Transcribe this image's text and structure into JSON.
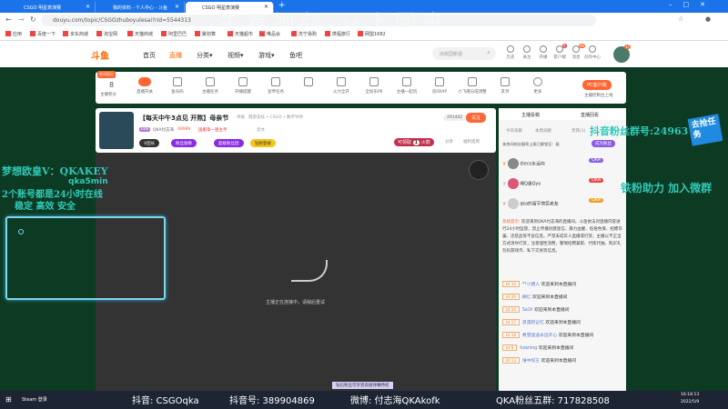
{
  "browser": {
    "tabs": [
      {
        "title": "CSGO 明星表演赛",
        "active": false
      },
      {
        "title": "我的资料 - 个人中心 - 斗鱼",
        "active": false
      },
      {
        "title": "CSGO 明星表演赛",
        "active": true
      }
    ],
    "url": "douyu.com/topic/CSGOzhuboyulesai?rid=5544313",
    "bookmarks": [
      "应用",
      "百度一下",
      "京东商城",
      "淘宝网",
      "天猫商城",
      "阿里巴巴",
      "聚划算",
      "天猫超市",
      "唯品会",
      "苏宁易购",
      "携程旅行",
      "网盟1682"
    ]
  },
  "watermark": "牛看视频 马上回来",
  "header": {
    "logo": "斗鱼",
    "nav": [
      "首页",
      "直播",
      "分类▾",
      "视频▾",
      "游戏▾",
      "鱼吧"
    ],
    "active_nav": "直播",
    "search_placeholder": "出校园新视",
    "icons": [
      "历史",
      "关注",
      "开播",
      "客户端",
      "消息",
      "创作中心"
    ],
    "msg_badge": "99",
    "client_badge": "9",
    "avatar_badge": "17"
  },
  "toolbar": {
    "score_tag": "房间积分",
    "score": "8",
    "score_label": "主播积分",
    "items": [
      "直播开关",
      "鱼乐码",
      "主播任务",
      "开播提醒",
      "宣传任务",
      "火力全开",
      "全民乐PK",
      "主播一起玩",
      "房间VIP",
      "小飞碟分成调整",
      "友邻",
      "更多"
    ],
    "pc_button": "PC客户端",
    "pc_sub": "主播控制台上线"
  },
  "room": {
    "title": "【每天中午3点见 开熬】母亲节",
    "tag": "举报",
    "category": "网游竞技 • CSGO • 数字导师",
    "level": "LV8",
    "anchor": "QKA付志海",
    "hot": "48989",
    "rank": "国服第一狙主手",
    "location": "云文",
    "pills": [
      "V团长",
      "粉丝勋章",
      "超级粉丝团",
      "钻粉登录"
    ],
    "follow_count": "291402",
    "follow": "关注",
    "fire": "可领取",
    "fire_num": "1",
    "fire_suffix": "火箭",
    "share": "分享",
    "report": "福利签到"
  },
  "video": {
    "status": "主播正在连接中，请稍后重试"
  },
  "chat": {
    "tabs": [
      "主播投稿",
      "直播回看"
    ],
    "rank_tabs": [
      "今日贡献",
      "本周贡献",
      "贵宾(1)"
    ],
    "upgrade_text": "本房间粉丝徽章上限已解锁至：级",
    "upgrade_button": "成为粉丝",
    "top": [
      {
        "name": "dieco永远向",
        "badge": "QKA"
      },
      {
        "name": "啊Q是Qyo",
        "badge": "QKA"
      },
      {
        "name": "qka的富平营民老友",
        "badge": "QKA"
      }
    ],
    "system_label": "系统提示:",
    "system": "欢迎来到QKA付志海的直播间。斗鱼依法对直播内容进行24小时监管，禁止传播封建迷信、暴力血腥、低俗色情、招嫖诈骗、违禁品等不良信息。严禁未成年人直播或打赏，主播以不正当方式诱导打赏，注意理性消费，警惕招聘兼职、代练代抽、购买礼包码游戏币、私下交易等信息。",
    "messages": [
      {
        "lv": "LV 10",
        "name": "**小猪人",
        "text": "欢迎来到本直播间"
      },
      {
        "lv": "LV 20",
        "name": "摘忆",
        "text": "欢迎来到本直播间"
      },
      {
        "lv": "LV 24",
        "name": "Sa1li",
        "text": "欢迎来到本直播间"
      },
      {
        "lv": "LV 17",
        "name": "浪漫的记忆",
        "text": "欢迎来到本直播间"
      },
      {
        "lv": "LV 18",
        "name": "希望迪迪永远开心",
        "text": "欢迎来到本直播间"
      },
      {
        "lv": "LV 8",
        "name": "hzaning",
        "text": "欢迎来到本直播间"
      },
      {
        "lv": "LV 13",
        "name": "谁中校王",
        "text": "欢迎来到本直播间"
      }
    ]
  },
  "overlay": {
    "left": [
      "梦想欧皇V：QKAKEY",
      "qka5min",
      "2个账号都是24小时在线",
      "稳定 高效 安全"
    ],
    "right": [
      "抖音粉丝群号:24963",
      "铁粉助力 加入微群"
    ],
    "task": "去抢任务"
  },
  "taskbar": {
    "app": "Steam 登录",
    "ticker": [
      "抖音: CSGOqka",
      "抖音号: 389904869",
      "微博: 付志海QKAkofk",
      "QKA粉丝五群: 717828508"
    ],
    "time": "16:18:13",
    "date": "2022/5/9",
    "popup": "钻石粉丝可享受高级弹幕特权"
  }
}
